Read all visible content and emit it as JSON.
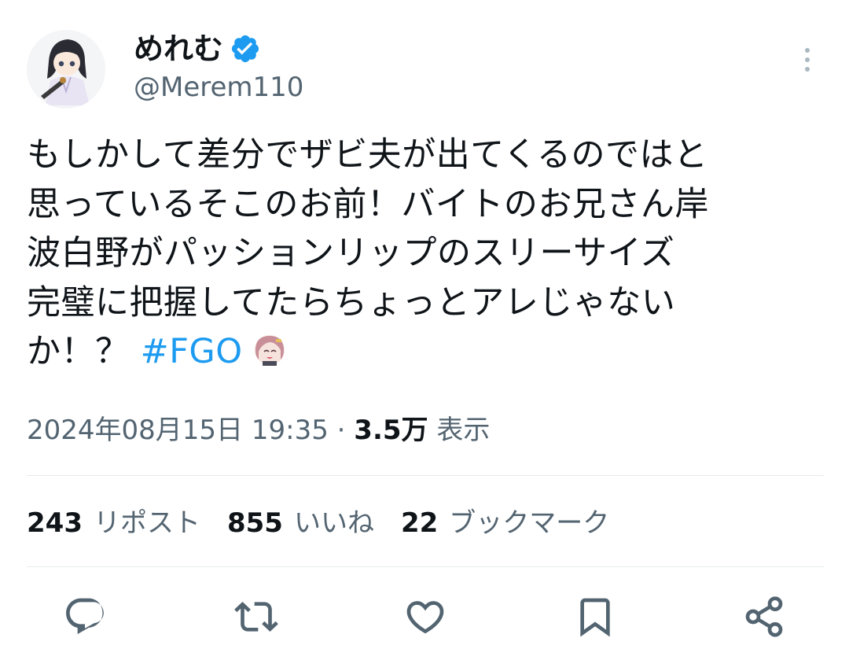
{
  "author": {
    "display_name": "めれむ",
    "handle": "@Merem110",
    "verified": true
  },
  "tweet": {
    "lines": [
      "もしかして差分でザビ夫が出てくるのではと",
      "思っているそこのお前！バイトのお兄さん岸",
      "波白野がパッションリップのスリーサイズ",
      "完璧に把握してたらちょっとアレじゃない"
    ],
    "last_line_text": "か！？ ",
    "hashtag": "#FGO",
    "trailing_emoji": "character-face-emoji"
  },
  "meta": {
    "timestamp": "2024年08月15日 19:35",
    "separator": "·",
    "views_count": "3.5万",
    "views_label": "表示"
  },
  "stats": {
    "reposts_count": "243",
    "reposts_label": "リポスト",
    "likes_count": "855",
    "likes_label": "いいね",
    "bookmarks_count": "22",
    "bookmarks_label": "ブックマーク"
  },
  "icons": {
    "more": "more-vertical-icon",
    "reply": "reply-icon",
    "retweet": "retweet-icon",
    "like": "heart-icon",
    "bookmark": "bookmark-icon",
    "share": "share-icon"
  },
  "colors": {
    "accent": "#1d9bf0",
    "text_primary": "#0f1419",
    "text_secondary": "#536471",
    "divider": "#e6e9ec"
  }
}
